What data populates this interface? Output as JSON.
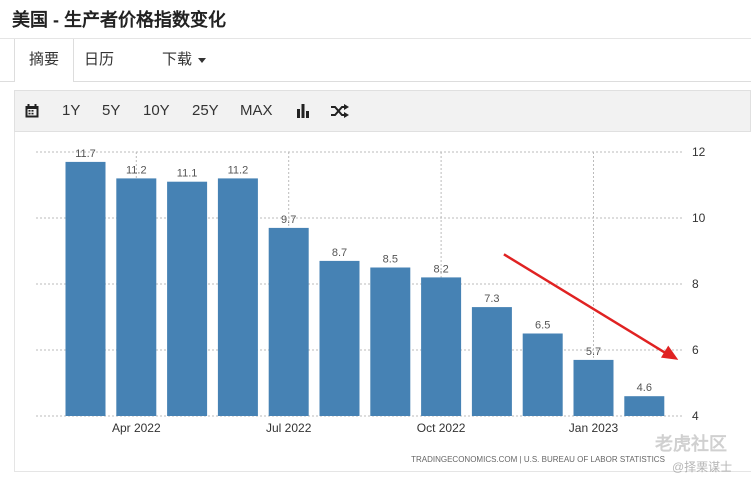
{
  "page": {
    "title": "美国 - 生产者价格指数变化"
  },
  "tabs": [
    {
      "label": "摘要"
    },
    {
      "label": "日历"
    },
    {
      "label": "下载"
    }
  ],
  "toolbar": {
    "ranges": [
      "1Y",
      "5Y",
      "10Y",
      "25Y",
      "MAX"
    ],
    "icons": [
      "calendar-icon",
      "bar-chart-icon",
      "shuffle-icon"
    ]
  },
  "chart_data": {
    "type": "bar",
    "categories": [
      "2022-03",
      "2022-04",
      "2022-05",
      "2022-06",
      "2022-07",
      "2022-08",
      "2022-09",
      "2022-10",
      "2022-11",
      "2022-12",
      "2023-01",
      "2023-02"
    ],
    "values": [
      11.7,
      11.2,
      11.1,
      11.2,
      9.7,
      8.7,
      8.5,
      8.2,
      7.3,
      6.5,
      5.7,
      4.6
    ],
    "data_labels": [
      "11.7",
      "11.2",
      "11.1",
      "11.2",
      "9.7",
      "8.7",
      "8.5",
      "8.2",
      "7.3",
      "6.5",
      "5.7",
      "4.6"
    ],
    "x_tick_labels": [
      {
        "label": "Apr 2022",
        "index": 1
      },
      {
        "label": "Jul 2022",
        "index": 4
      },
      {
        "label": "Oct 2022",
        "index": 7
      },
      {
        "label": "Jan 2023",
        "index": 10
      }
    ],
    "y_ticks": [
      4,
      6,
      8,
      10,
      12
    ],
    "ylim": [
      4,
      12
    ],
    "y_axis_side": "right",
    "grid": "dotted",
    "bar_color": "#4682b4",
    "arrow_color": "#e02222",
    "source": "TRADINGECONOMICS.COM  |  U.S. BUREAU OF LABOR STATISTICS"
  },
  "watermarks": [
    "老虎社区",
    "@择栗谋士"
  ]
}
